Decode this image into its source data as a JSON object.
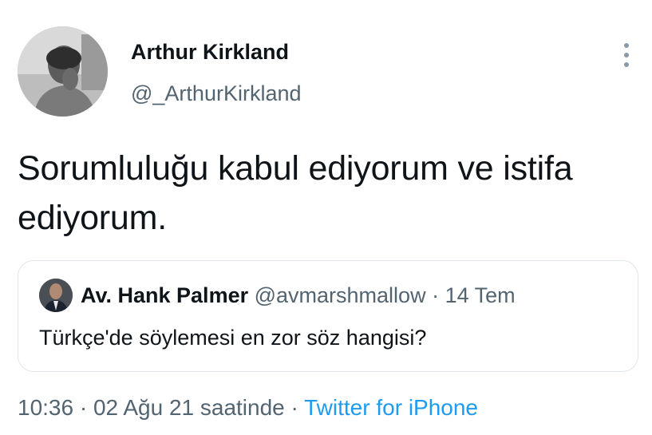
{
  "author": {
    "display_name": "Arthur Kirkland",
    "handle": "@_ArthurKirkland",
    "avatar": "avatar-photo-man-hand-on-chin"
  },
  "more_icon": "more-vertical-dots-icon",
  "tweet": {
    "text": "Sorumluluğu kabul ediyorum ve istifa ediyorum."
  },
  "quoted": {
    "display_name": "Av. Hank Palmer",
    "handle": "@avmarshmallow",
    "separator": " · ",
    "date": "14 Tem",
    "text": "Türkçe'de söylemesi en zor söz hangisi?",
    "avatar": "avatar-photo-man-in-suit"
  },
  "footer": {
    "time": "10:36",
    "dot1": " · ",
    "date": "02 Ağu 21 saatinde",
    "dot2": " · ",
    "source": "Twitter for iPhone"
  },
  "colors": {
    "text_primary": "#0f1419",
    "text_secondary": "#536471",
    "link": "#1d9bf0",
    "border": "#e1e6ea"
  }
}
